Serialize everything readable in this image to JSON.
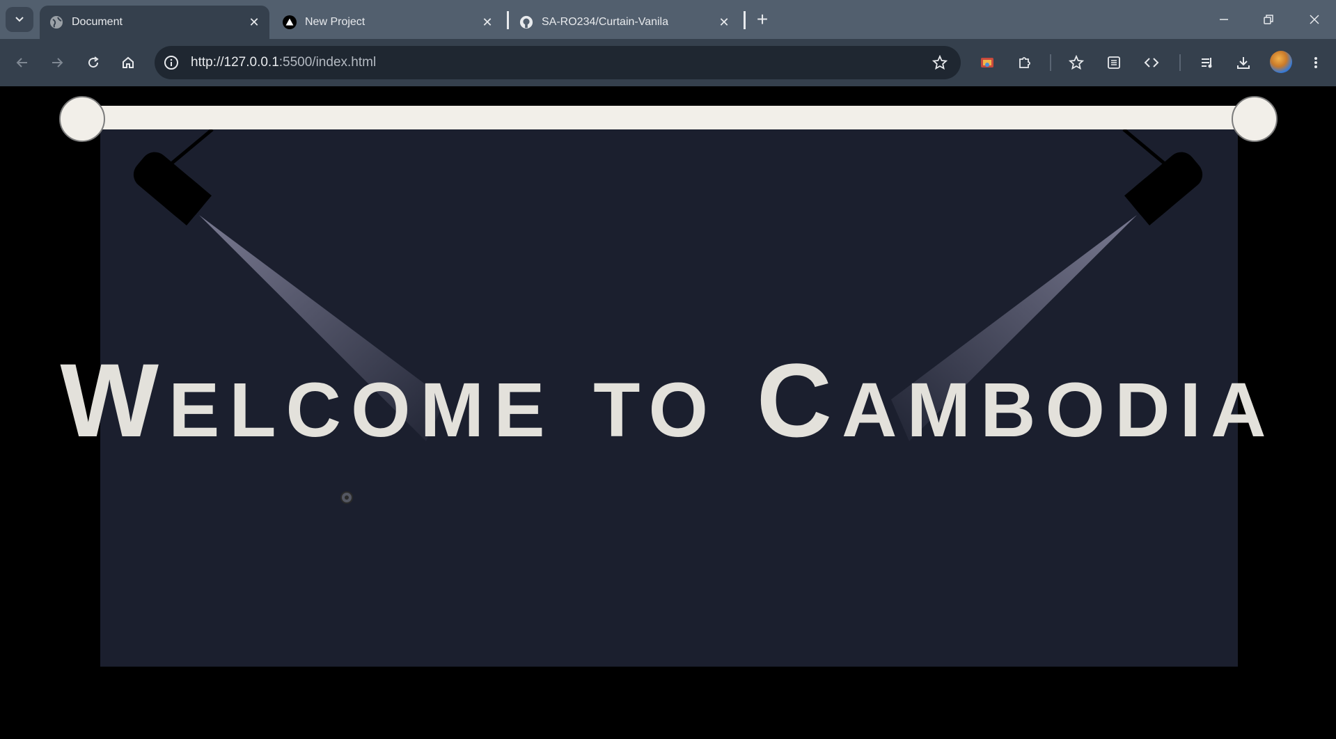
{
  "browser": {
    "tabs": [
      {
        "title": "Document",
        "active": true,
        "favicon": "globe-icon"
      },
      {
        "title": "New Project",
        "active": false,
        "favicon": "triangle-logo-icon"
      },
      {
        "title": "SA-RO234/Curtain-Vanila",
        "active": false,
        "favicon": "github-icon"
      }
    ],
    "address": {
      "url_host": "http://127.0.0.1",
      "url_rest": ":5500/index.html"
    }
  },
  "page": {
    "headline": {
      "w_initial": "W",
      "w_rest": "ELCOME",
      "to": "TO",
      "c_initial": "C",
      "c_rest": "AMBODIA"
    }
  },
  "colors": {
    "tabstrip": "#525f6e",
    "toolbar": "#35404d",
    "stage": "#1b1f2e",
    "rod": "#f2efe9",
    "headline": "#e3e1db"
  }
}
